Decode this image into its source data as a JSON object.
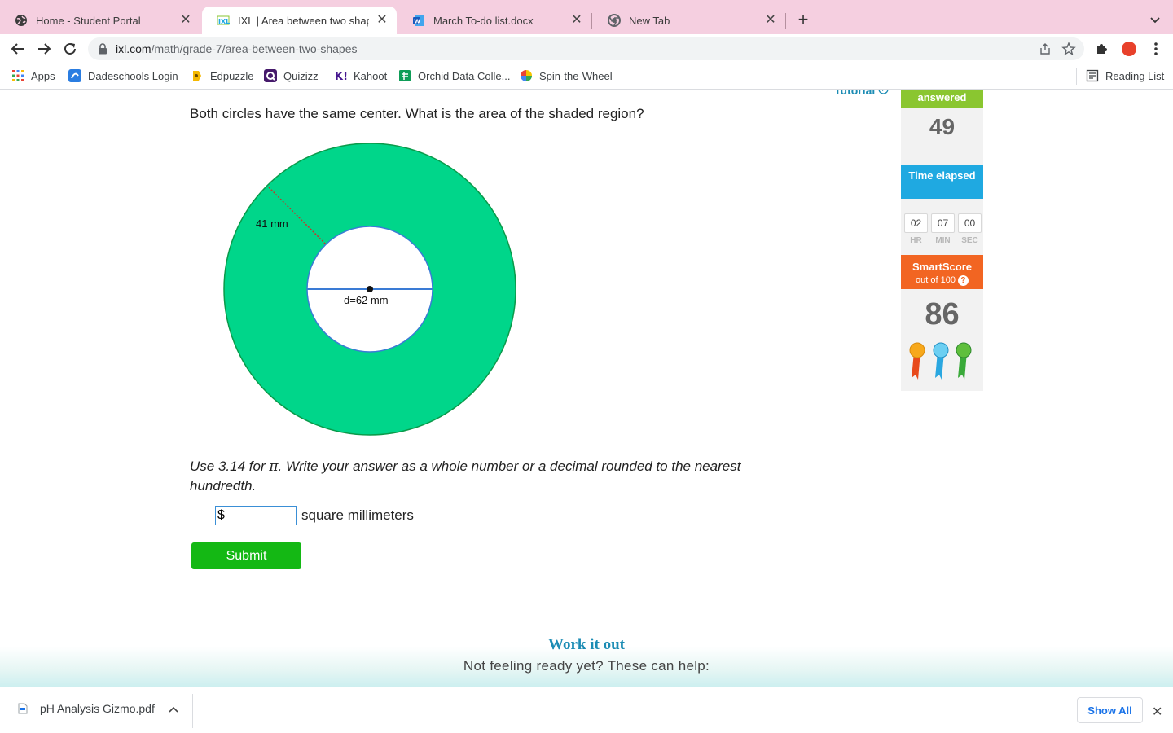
{
  "browser": {
    "tabs": [
      {
        "title": "Home - Student Portal",
        "active": false
      },
      {
        "title": "IXL | Area between two shapes",
        "active": true
      },
      {
        "title": "March To-do list.docx",
        "active": false
      },
      {
        "title": "New Tab",
        "active": false
      }
    ],
    "url_host": "ixl.com",
    "url_path": "/math/grade-7/area-between-two-shapes",
    "bookmarks": [
      {
        "label": "Apps"
      },
      {
        "label": "Dadeschools Login"
      },
      {
        "label": "Edpuzzle"
      },
      {
        "label": "Quizizz"
      },
      {
        "label": "Kahoot"
      },
      {
        "label": "Orchid Data Colle..."
      },
      {
        "label": "Spin-the-Wheel"
      }
    ],
    "reading_list": "Reading List"
  },
  "question": {
    "tutorial_label": "Tutorial",
    "prompt": "Both circles have the same center. What is the area of the shaded region?",
    "figure": {
      "outer_label": "41 mm",
      "inner_label": "d=62 mm",
      "fill_color": "#00d68a",
      "stroke_color": "#0a9a4a"
    },
    "instructions_before_pi": "Use 3.14 for ",
    "pi_symbol": "π",
    "instructions_after_pi": ". Write your answer as a whole number or a decimal rounded to the nearest hundredth.",
    "answer_value": "$",
    "answer_unit": "square millimeters",
    "submit_label": "Submit"
  },
  "work_it_out": {
    "title": "Work it out",
    "subtitle": "Not feeling ready yet? These can help:"
  },
  "stats": {
    "answered_label": "answered",
    "answered_value": "49",
    "time_label": "Time elapsed",
    "timer": [
      {
        "value": "02",
        "unit": "HR"
      },
      {
        "value": "07",
        "unit": "MIN"
      },
      {
        "value": "00",
        "unit": "SEC"
      }
    ],
    "smartscore_label": "SmartScore",
    "smartscore_sub": "out of 100",
    "smartscore_help": "?",
    "smartscore_value": "86",
    "medal_colors": [
      "#e84a1c",
      "#2aa7e0",
      "#3aaa3a"
    ]
  },
  "downloads": {
    "file_name": "pH Analysis Gizmo.pdf",
    "show_all_label": "Show All"
  }
}
